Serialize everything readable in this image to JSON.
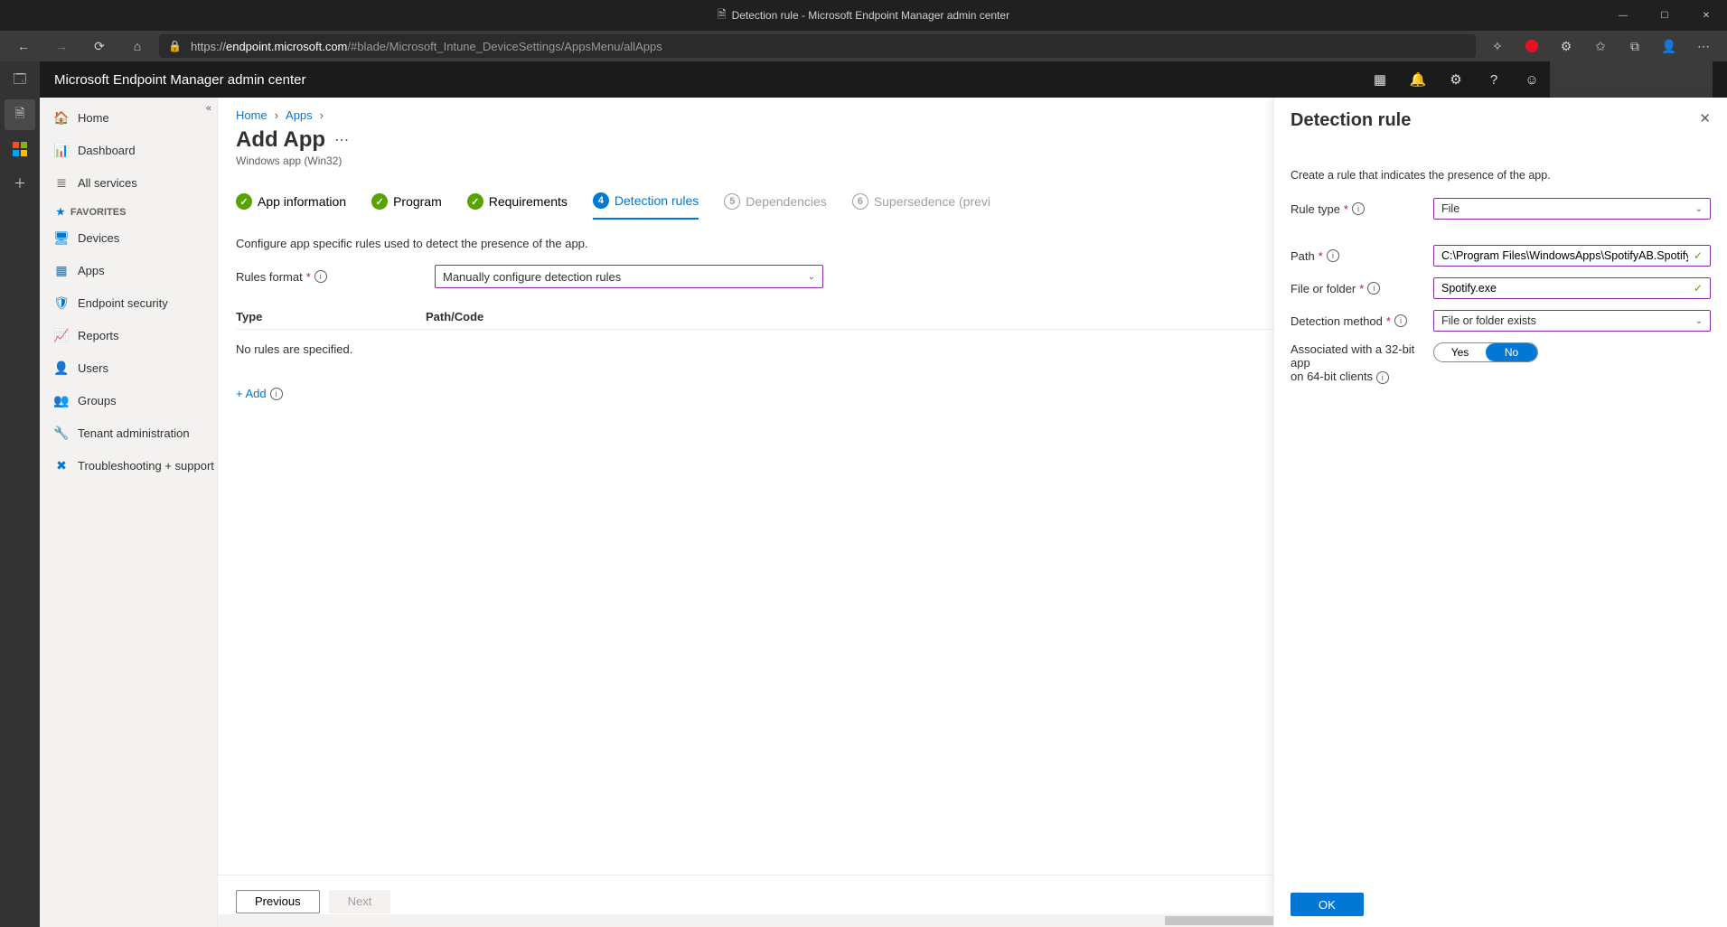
{
  "window": {
    "title": "Detection rule - Microsoft Endpoint Manager admin center"
  },
  "browser": {
    "url_prefix": "https://",
    "url_domain": "endpoint.microsoft.com",
    "url_path": "/#blade/Microsoft_Intune_DeviceSettings/AppsMenu/allApps"
  },
  "portal_header": {
    "title": "Microsoft Endpoint Manager admin center"
  },
  "nav": {
    "home": "Home",
    "dashboard": "Dashboard",
    "all_services": "All services",
    "favorites_label": "FAVORITES",
    "devices": "Devices",
    "apps": "Apps",
    "endpoint_security": "Endpoint security",
    "reports": "Reports",
    "users": "Users",
    "groups": "Groups",
    "tenant_admin": "Tenant administration",
    "troubleshooting": "Troubleshooting + support"
  },
  "breadcrumb": {
    "home": "Home",
    "apps": "Apps"
  },
  "page": {
    "title": "Add App",
    "subtitle": "Windows app (Win32)"
  },
  "steps": {
    "s1": "App information",
    "s2": "Program",
    "s3": "Requirements",
    "s4": "Detection rules",
    "s5": "Dependencies",
    "s6": "Supersedence (previ",
    "n4": "4",
    "n5": "5",
    "n6": "6"
  },
  "detect": {
    "desc": "Configure app specific rules used to detect the presence of the app.",
    "rules_format_label": "Rules format",
    "rules_format_value": "Manually configure detection rules",
    "col_type": "Type",
    "col_path": "Path/Code",
    "empty": "No rules are specified.",
    "add": "+ Add"
  },
  "footer": {
    "previous": "Previous",
    "next": "Next"
  },
  "panel": {
    "title": "Detection rule",
    "desc": "Create a rule that indicates the presence of the app.",
    "rule_type_label": "Rule type",
    "rule_type_value": "File",
    "path_label": "Path",
    "path_value": "C:\\Program Files\\WindowsApps\\SpotifyAB.SpotifyMusic_...",
    "file_label": "File or folder",
    "file_value": "Spotify.exe",
    "method_label": "Detection method",
    "method_value": "File or folder exists",
    "assoc_label1": "Associated with a 32-bit app",
    "assoc_label2": "on 64-bit clients",
    "yes": "Yes",
    "no": "No",
    "ok": "OK"
  }
}
